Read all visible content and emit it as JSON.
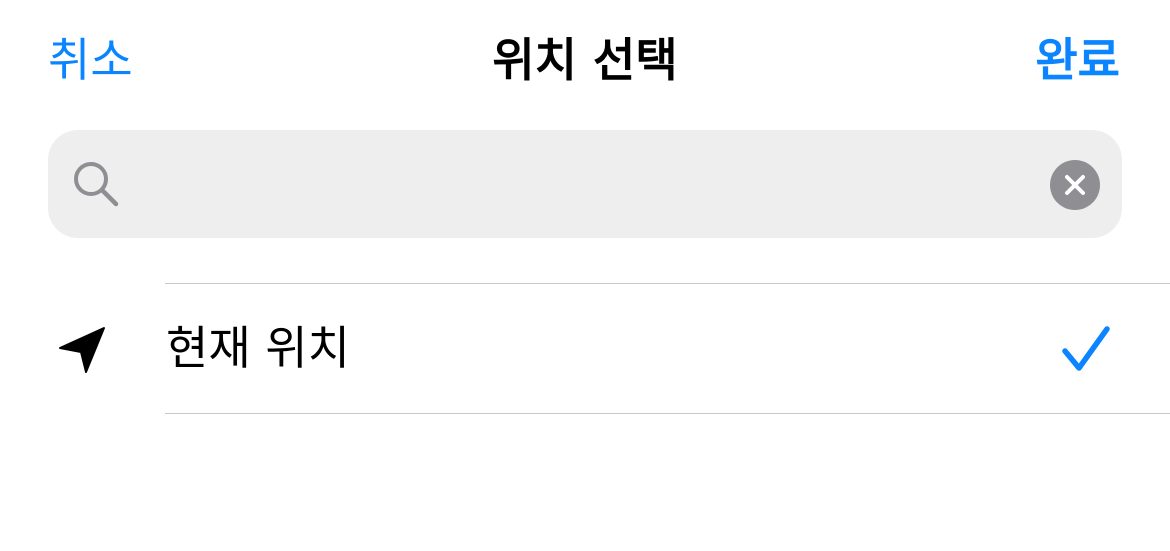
{
  "nav": {
    "cancel_label": "취소",
    "title": "위치 선택",
    "done_label": "완료"
  },
  "search": {
    "value": "",
    "placeholder": "",
    "icon": "magnifier-icon",
    "clear_icon": "clear-circle-x-icon"
  },
  "list": {
    "items": [
      {
        "label": "현재 위치",
        "icon": "location-arrow-icon",
        "selected": true,
        "accessory_icon": "checkmark-icon"
      }
    ]
  },
  "colors": {
    "accent": "#0a84ff",
    "search_background": "#eeeeef",
    "icon_gray": "#8e8e93",
    "separator": "#c8c8cc"
  }
}
